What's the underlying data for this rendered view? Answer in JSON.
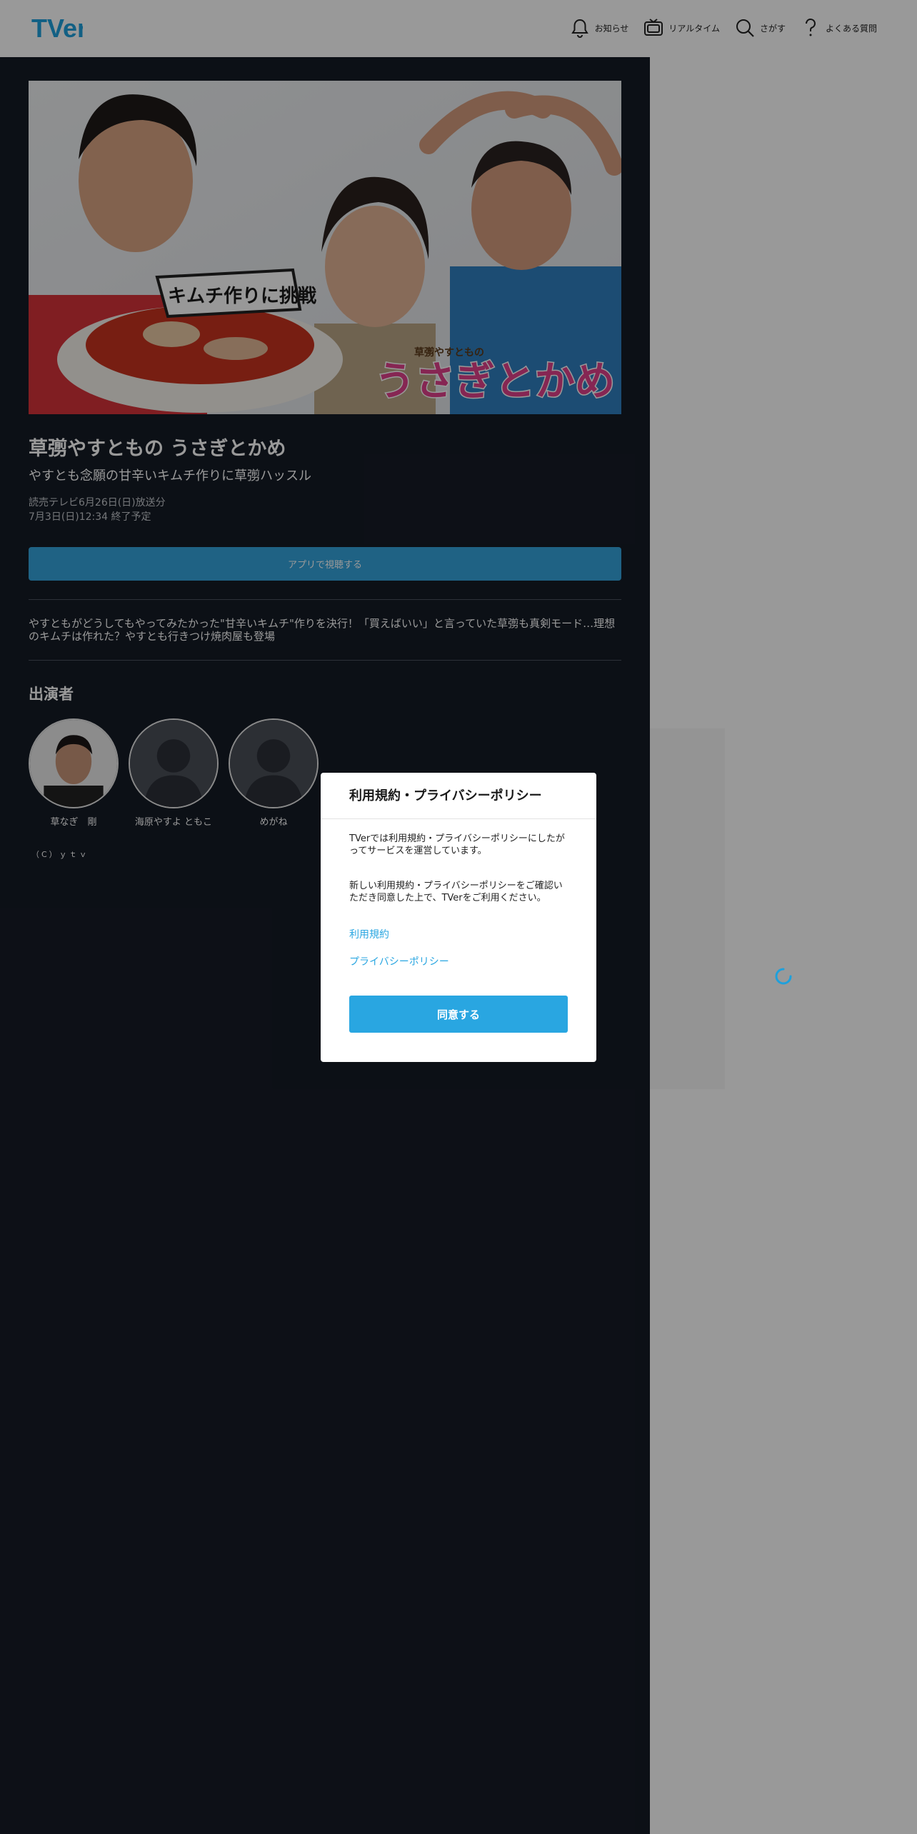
{
  "header": {
    "logo_text": "TVer",
    "nav": [
      {
        "icon": "bell-icon",
        "label": "お知らせ"
      },
      {
        "icon": "tv-icon",
        "label": "リアルタイム"
      },
      {
        "icon": "search-icon",
        "label": "さがす"
      },
      {
        "icon": "question-icon",
        "label": "よくある質問"
      }
    ]
  },
  "episode": {
    "title": "草彅やすともの うさぎとかめ",
    "subtitle": "やすとも念願の甘辛いキムチ作りに草彅ハッスル",
    "broadcast": "読売テレビ6月26日(日)放送分",
    "expires": "7月3日(日)12:34 終了予定",
    "app_button": "アプリで視聴する",
    "description": "やすともがどうしてもやってみたかった\"甘辛いキムチ\"作りを決行！「買えばいい」と言っていた草彅も真剣モード…理想のキムチは作れた？やすとも行きつけ焼肉屋も登場",
    "thumbnail_text": {
      "caption": "キムチ作りに挑戦",
      "show_small": "草彅やすともの",
      "show_logo": "うさぎとかめ"
    }
  },
  "cast": {
    "heading": "出演者",
    "members": [
      {
        "name": "草なぎ　剛"
      },
      {
        "name": "海原やすよ ともこ"
      },
      {
        "name": "めがね"
      }
    ]
  },
  "copyright": "（C）ｙｔｖ",
  "modal": {
    "title": "利用規約・プライバシーポリシー",
    "paragraph1": "TVerでは利用規約・プライバシーポリシーにしたがってサービスを運営しています。",
    "paragraph2": "新しい利用規約・プライバシーポリシーをご確認いただき同意した上で、TVerをご利用ください。",
    "link_terms": "利用規約",
    "link_privacy": "プライバシーポリシー",
    "agree_button": "同意する"
  },
  "colors": {
    "accent": "#29a6e1",
    "main_bg": "#151b26"
  }
}
